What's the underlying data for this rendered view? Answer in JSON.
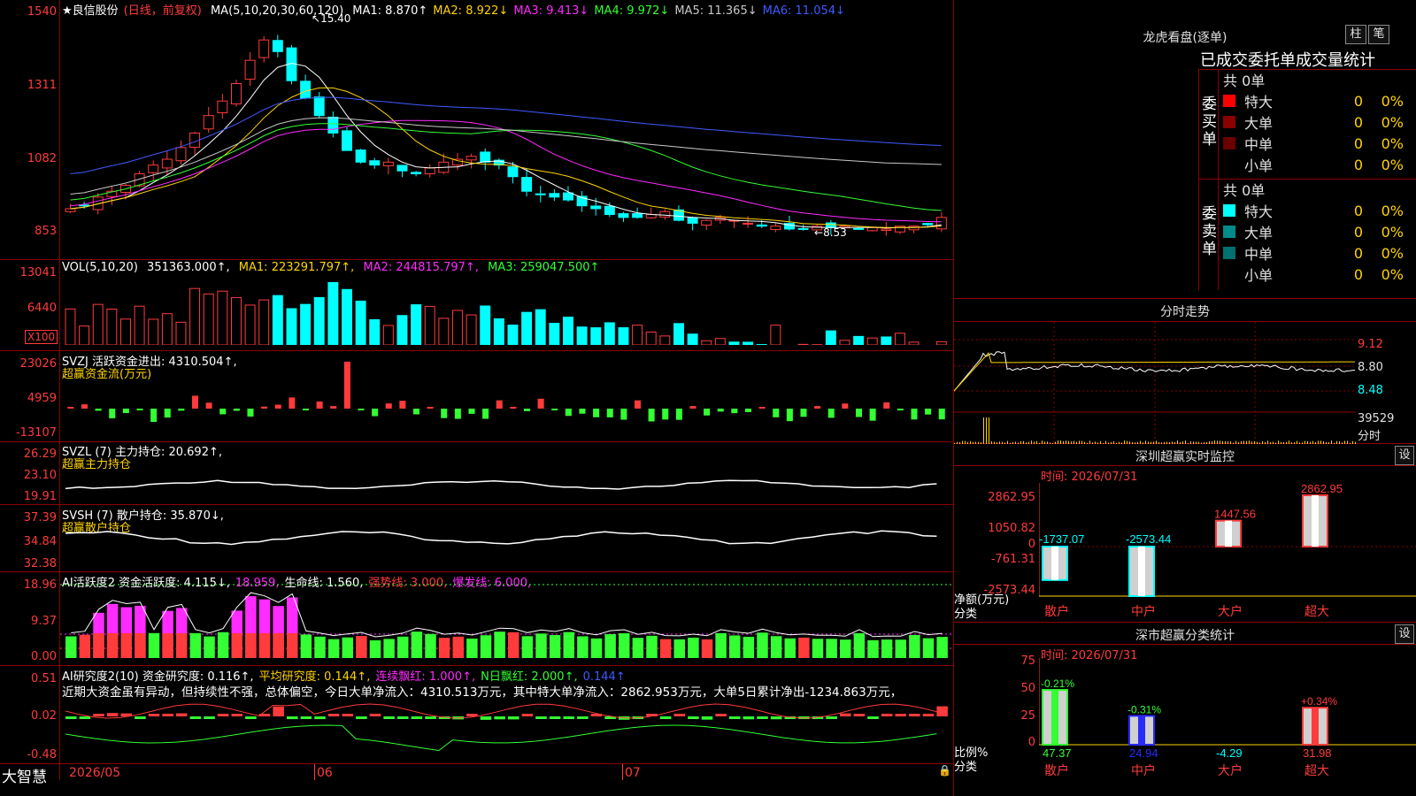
{
  "kline": {
    "title_star": "★",
    "stock_name": "良信股份",
    "period_label": "(日线，前复权)",
    "ma_def": "MA(5,10,20,30,60,120)",
    "ma": [
      {
        "label": "MA1: 8.870↑",
        "color": "#ffffff"
      },
      {
        "label": "MA2: 8.922↓",
        "color": "#ffd400"
      },
      {
        "label": "MA3: 9.413↓",
        "color": "#ff2bff"
      },
      {
        "label": "MA4: 9.972↓",
        "color": "#33ff33"
      },
      {
        "label": "MA5: 11.365↓",
        "color": "#c8c8c8"
      },
      {
        "label": "MA6: 11.054↓",
        "color": "#3f5bff"
      }
    ],
    "y_ticks": [
      "1540",
      "1311",
      "1082",
      "853"
    ],
    "high_note": "15.40",
    "low_note": "8.53"
  },
  "vol": {
    "title": "VOL(5,10,20)",
    "value": "351363.000↑,",
    "ma1": "MA1: 223291.797↑,",
    "ma2": "MA2: 244815.797↑,",
    "ma3": "MA3: 259047.500↑",
    "y_ticks": [
      "13041",
      "6440"
    ],
    "unit": "X100"
  },
  "svzj": {
    "title": "SVZJ  活跃资金进出: 4310.504↑,",
    "subtitle": "超赢资金流(万元)",
    "y_ticks": [
      "23026",
      "4959",
      "-13107"
    ]
  },
  "svzl": {
    "title": "SVZL (7) 主力持仓: 20.692↑,",
    "subtitle": "超赢主力持仓",
    "y_ticks": [
      "26.29",
      "23.10",
      "19.91"
    ]
  },
  "svsh": {
    "title": "SVSH (7) 散户持仓: 35.870↓,",
    "subtitle": "超赢散户持仓",
    "y_ticks": [
      "37.39",
      "34.84",
      "32.38"
    ]
  },
  "ai1": {
    "title": "AI活跃度2 资金活跃度: 4.115↓,",
    "v2": "18.959,",
    "life": "生命线: 1.560,",
    "strong": "强势线: 3.000,",
    "burst": "爆发线: 6.000,",
    "y_ticks": [
      "18.96",
      "9.37",
      "0.00"
    ]
  },
  "ai2": {
    "title": "AI研究度2(10) 资金研究度: 0.116↑,",
    "avg": "平均研究度: 0.144↑,",
    "lian": "连续飘红: 1.000↑,",
    "nday": "N日飘红: 2.000↑,",
    "last": "0.144↑",
    "comment": "近期大资金虽有异动，但持续性不强，总体偏空，今日大单净流入：4310.513万元，其中特大单净流入：2862.953万元，大单5日累计净出-1234.863万元，",
    "y_ticks": [
      "0.51",
      "0.02",
      "-0.48"
    ]
  },
  "bottom": {
    "brand": "大智慧",
    "dates": [
      "2026/05",
      "06",
      "07"
    ]
  },
  "lhb": {
    "title": "龙虎看盘(逐单)",
    "btn_bar": "柱",
    "btn_pen": "笔",
    "section_title": "已成交委托单成交量统计",
    "buy_label": "委买单",
    "sell_label": "委卖单",
    "buy_total": "共 0单",
    "sell_total": "共 0单",
    "buy_rows": [
      {
        "name": "特大",
        "count": "0",
        "pct": "0%",
        "color": "#ff0000"
      },
      {
        "name": "大单",
        "count": "0",
        "pct": "0%",
        "color": "#8b0000"
      },
      {
        "name": "中单",
        "count": "0",
        "pct": "0%",
        "color": "#6b0000"
      },
      {
        "name": "小单",
        "count": "0",
        "pct": "0%",
        "color": ""
      }
    ],
    "sell_rows": [
      {
        "name": "特大",
        "count": "0",
        "pct": "0%",
        "color": "#00ffff"
      },
      {
        "name": "大单",
        "count": "0",
        "pct": "0%",
        "color": "#008b8b"
      },
      {
        "name": "中单",
        "count": "0",
        "pct": "0%",
        "color": "#007070"
      },
      {
        "name": "小单",
        "count": "0",
        "pct": "0%",
        "color": ""
      }
    ]
  },
  "minute": {
    "title": "分时走势",
    "y_ticks": [
      "9.12",
      "8.80",
      "8.48"
    ],
    "vol_tick": "39529",
    "vol_label": "分时"
  },
  "monitor": {
    "title": "深圳超赢实时监控",
    "btn": "设",
    "time": "时间: 2026/07/31",
    "y_ticks": [
      "2862.95",
      "1050.82",
      "0",
      "-761.31",
      "-2573.44"
    ],
    "left_label1": "净额(万元)",
    "left_label2": "分类",
    "bars": [
      {
        "label": "散户",
        "value": "-1737.07",
        "num": -1737.07
      },
      {
        "label": "中户",
        "value": "-2573.44",
        "num": -2573.44
      },
      {
        "label": "大户",
        "value": "1447.56",
        "num": 1447.56
      },
      {
        "label": "超大",
        "value": "2862.95",
        "num": 2862.95
      }
    ]
  },
  "category": {
    "title": "深市超赢分类统计",
    "btn": "设",
    "time": "时间: 2026/07/31",
    "y_ticks": [
      "75",
      "50",
      "25",
      "0"
    ],
    "left_label1": "比例%",
    "left_label2": "分类",
    "bars": [
      {
        "label": "散户",
        "pct": "47.37",
        "delta": "-0.21%",
        "num": 47.37,
        "color": "#33ff33"
      },
      {
        "label": "中户",
        "pct": "24.94",
        "delta": "-0.31%",
        "num": 24.94,
        "color": "#2a2aff"
      },
      {
        "label": "大户",
        "pct": "-4.29",
        "delta": "",
        "num": 0,
        "color": "#ff3b3b"
      },
      {
        "label": "超大",
        "pct": "31.98",
        "delta": "+0.34%",
        "num": 31.98,
        "color": "#ff3b3b"
      }
    ]
  }
}
